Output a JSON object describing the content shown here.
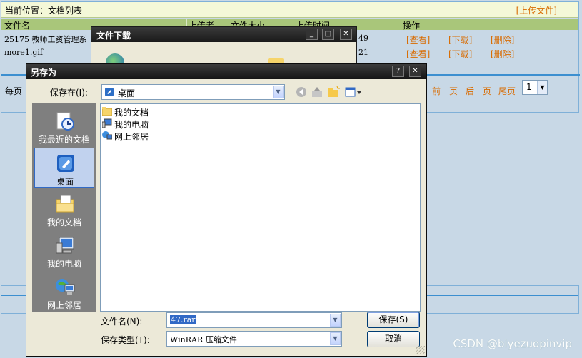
{
  "page": {
    "location_label": "当前位置：文档列表",
    "upload_link": "[上传文件]",
    "columns": [
      "文件名",
      "上传者",
      "文件大小",
      "上传时间",
      "操作"
    ],
    "rows": [
      {
        "filename": "25175 教师工资管理系",
        "time_fragment": "49",
        "actions": [
          "[查看]",
          "[下载]",
          "[删除]"
        ]
      },
      {
        "filename": "more1.gif",
        "time_fragment": "21",
        "actions": [
          "[查看]",
          "[下载]",
          "[删除]"
        ]
      }
    ],
    "pager": {
      "label_fragment": "每页",
      "prev": "前一页",
      "next": "后一页",
      "last": "尾页",
      "page": "1"
    }
  },
  "download_dialog": {
    "title": "文件下载"
  },
  "save_dialog": {
    "title": "另存为",
    "save_in_label": "保存在(I):",
    "save_in_value": "桌面",
    "places": [
      {
        "name": "recent",
        "label": "我最近的文档"
      },
      {
        "name": "desktop",
        "label": "桌面"
      },
      {
        "name": "mydocs",
        "label": "我的文档"
      },
      {
        "name": "mycomputer",
        "label": "我的电脑"
      },
      {
        "name": "network",
        "label": "网上邻居"
      }
    ],
    "files": [
      {
        "label": "我的文档"
      },
      {
        "label": "我的电脑"
      },
      {
        "label": "网上邻居"
      }
    ],
    "filename_label": "文件名(N):",
    "filename_value": "47.rar",
    "filetype_label": "保存类型(T):",
    "filetype_value": "WinRAR 压缩文件",
    "save_button": "保存(S)",
    "cancel_button": "取消"
  },
  "watermark": "CSDN @biyezuopinvip",
  "colors": {
    "title_bar": "#1a1a1a",
    "accent_link": "#d96b00",
    "header_bg": "#a9c67a",
    "selection": "#3169c6"
  }
}
